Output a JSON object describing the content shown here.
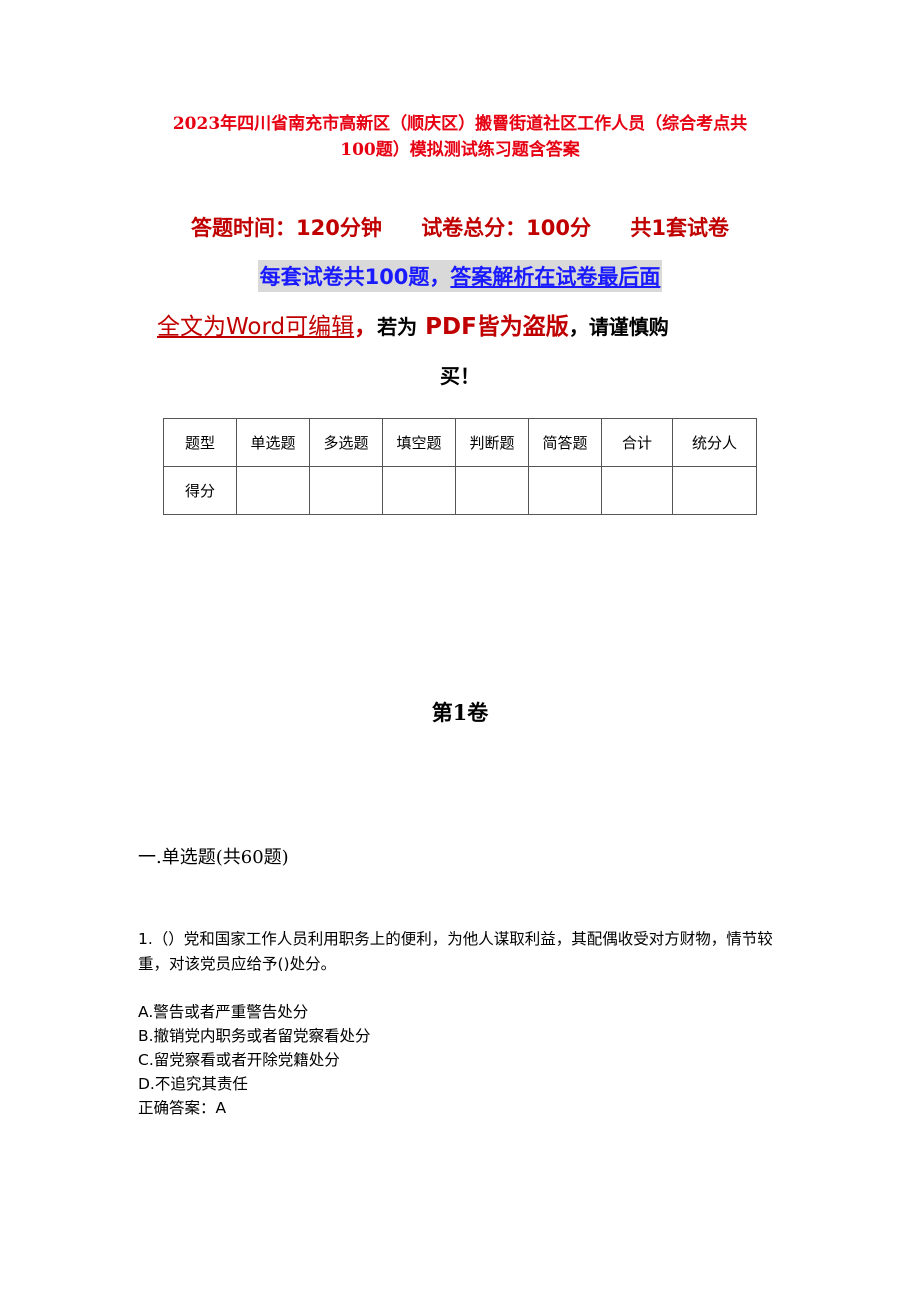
{
  "document": {
    "title_line1": "2023年四川省南充市高新区（顺庆区）搬罾街道社区工作人员（综合考点共",
    "title_line2": "100题）模拟测试练习题含答案",
    "meta": {
      "time": "答题时间：120分钟",
      "total": "试卷总分：100分",
      "sets": "共1套试卷"
    },
    "notice": {
      "part1": "每套试卷共100题，",
      "part2": "答案解析在试卷最后面"
    },
    "editable": {
      "word": "全文为Word可编辑",
      "comma1": "，",
      "if": "若为",
      "pdf": "PDF皆为盗版",
      "comma2": "，",
      "buy1": "请谨慎购",
      "buy2": "买！"
    },
    "score_table": {
      "headers": [
        "题型",
        "单选题",
        "多选题",
        "填空题",
        "判断题",
        "简答题",
        "合计",
        "统分人"
      ],
      "row_label": "得分",
      "values": [
        "",
        "",
        "",
        "",
        "",
        "",
        ""
      ]
    },
    "volume": "第1卷",
    "section": "一.单选题(共60题)",
    "question": {
      "text": "1.（）党和国家工作人员利用职务上的便利，为他人谋取利益，其配偶收受对方财物，情节较重，对该党员应给予()处分。",
      "options": [
        "A.警告或者严重警告处分",
        "B.撤销党内职务或者留党察看处分",
        "C.留党察看或者开除党籍处分",
        "D.不追究其责任"
      ],
      "answer": "正确答案：A"
    }
  }
}
